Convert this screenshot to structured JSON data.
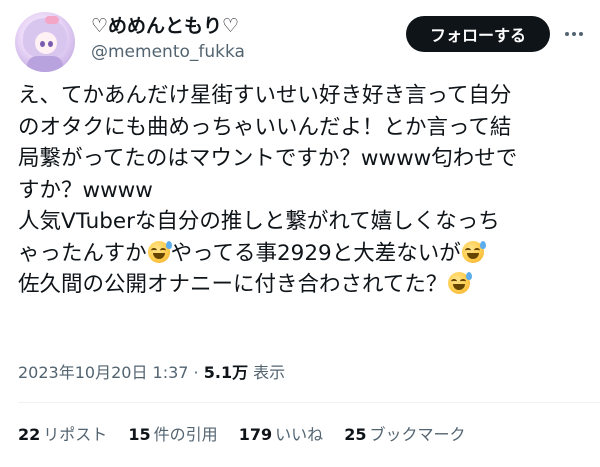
{
  "author": {
    "display_name": "♡めめんともり♡",
    "handle": "@memento_fukka"
  },
  "actions": {
    "follow_label": "フォローする"
  },
  "icons": {
    "more": "more-horizontal-icon",
    "emoji": "grinning-face-with-sweat-emoji"
  },
  "tweet": {
    "lines": [
      "え、てかあんだけ星街すいせい好き好き言って自分",
      "のオタクにも曲めっちゃいいんだよ！とか言って結",
      "局繋がってたのはマウントですか？wwww匂わせで",
      "すか？wwww",
      "人気VTuberな自分の推しと繋がれて嬉しくなっち",
      "ゃったんすか",
      "やってる事2929と大差ないが",
      "佐久間の公開オナニーに付き合わされてた？"
    ]
  },
  "meta": {
    "timestamp": "2023年10月20日 1:37",
    "separator": " · ",
    "views": "5.1万",
    "views_label": " 表示"
  },
  "stats": {
    "reposts": {
      "count": "22",
      "label": "リポスト"
    },
    "quotes": {
      "count": "15",
      "label": "件の引用"
    },
    "likes": {
      "count": "179",
      "label": "いいね"
    },
    "bookmarks": {
      "count": "25",
      "label": "ブックマーク"
    }
  },
  "colors": {
    "text": "#0f1419",
    "secondary": "#536471",
    "button_bg": "#0f1419",
    "divider": "#eff3f4"
  }
}
